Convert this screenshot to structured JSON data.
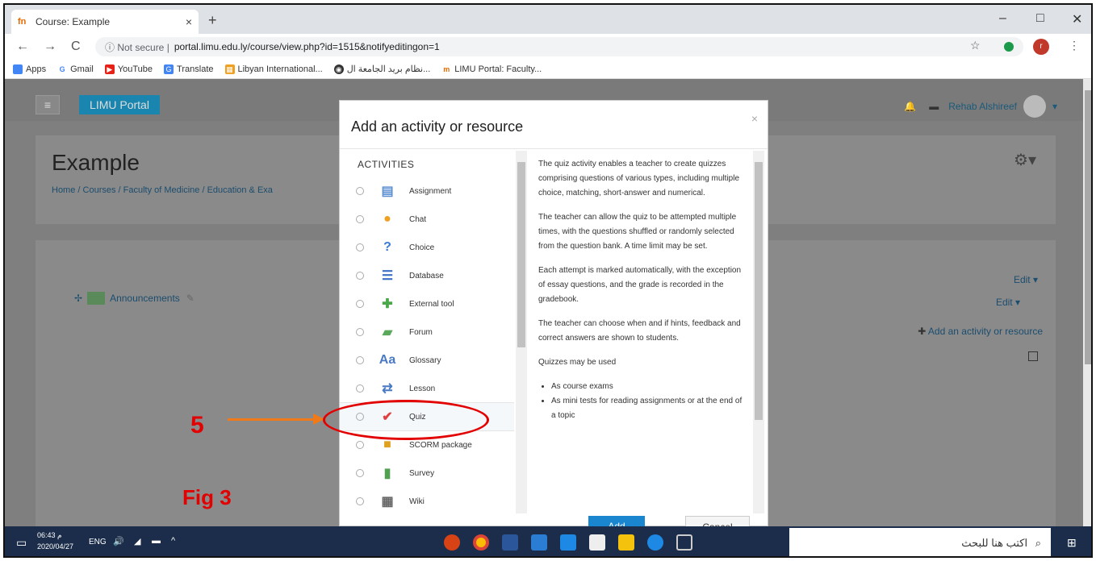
{
  "browser": {
    "tab_title": "Course: Example",
    "tab_favicon": "fn",
    "new_tab": "+",
    "close_tab": "×",
    "minimize": "–",
    "maximize": "□",
    "close_window": "✕",
    "back": "←",
    "forward": "→",
    "reload": "C",
    "security": "ⓘ Not secure |",
    "url": "portal.limu.edu.ly/course/view.php?id=1515&notifyeditingon=1",
    "star": "☆",
    "menu": "⋮",
    "profile": "r"
  },
  "bookmarks": [
    "Apps",
    "Gmail",
    "YouTube",
    "Translate",
    "Libyan International...",
    "نظام بريد الجامعة ال...",
    "LIMU Portal: Faculty..."
  ],
  "navbar": {
    "menu_icon": "≡",
    "brand": "LIMU Portal",
    "user_name": "Rehab Alshireef",
    "user_caret": "▾"
  },
  "course": {
    "title": "Example",
    "breadcrumb": "Home / Courses / Faculty of Medicine / Education & Exa",
    "gear": "⚙▾"
  },
  "section": {
    "announcements": "Announcements",
    "edit1": "Edit ▾",
    "edit2": "Edit ▾",
    "add_activity": "Add an activity or resource",
    "move": "✢",
    "pencil": "✎",
    "person": "👤"
  },
  "modal": {
    "title": "Add an activity or resource",
    "close": "×",
    "activities_heading": "ACTIVITIES",
    "items": [
      {
        "label": "Assignment",
        "icon": "▤",
        "color": "#5b8fd1"
      },
      {
        "label": "Chat",
        "icon": "●",
        "color": "#f0a020"
      },
      {
        "label": "Choice",
        "icon": "?",
        "color": "#3a7bd5"
      },
      {
        "label": "Database",
        "icon": "☰",
        "color": "#3b6fc4"
      },
      {
        "label": "External tool",
        "icon": "✚",
        "color": "#4aa84a"
      },
      {
        "label": "Forum",
        "icon": "▰",
        "color": "#5aa85a"
      },
      {
        "label": "Glossary",
        "icon": "Aa",
        "color": "#4a7ac4"
      },
      {
        "label": "Lesson",
        "icon": "⇄",
        "color": "#4a7ac4"
      },
      {
        "label": "Quiz",
        "icon": "✔",
        "color": "#e04040"
      },
      {
        "label": "SCORM package",
        "icon": "■",
        "color": "#e0a020"
      },
      {
        "label": "Survey",
        "icon": "▮",
        "color": "#50a050"
      },
      {
        "label": "Wiki",
        "icon": "▦",
        "color": "#666666"
      }
    ],
    "desc": {
      "p1": "The quiz activity enables a teacher to create quizzes comprising questions of various types, including multiple choice, matching, short-answer and numerical.",
      "p2": "The teacher can allow the quiz to be attempted multiple times, with the questions shuffled or randomly selected from the question bank. A time limit may be set.",
      "p3": "Each attempt is marked automatically, with the exception of essay questions, and the grade is recorded in the gradebook.",
      "p4": "The teacher can choose when and if hints, feedback and correct answers are shown to students.",
      "p5": "Quizzes may be used",
      "li1": "As course exams",
      "li2": "As mini tests for reading assignments or at the end of a topic"
    },
    "add_button": "Add",
    "cancel_button": "Cancel"
  },
  "annotation": {
    "step": "5",
    "figure": "Fig 3"
  },
  "taskbar": {
    "time": "06:43 م",
    "date": "2020/04/27",
    "lang": "ENG",
    "search_placeholder": "اكتب هنا للبحث",
    "search_icon": "⌕",
    "up_caret": "^"
  }
}
